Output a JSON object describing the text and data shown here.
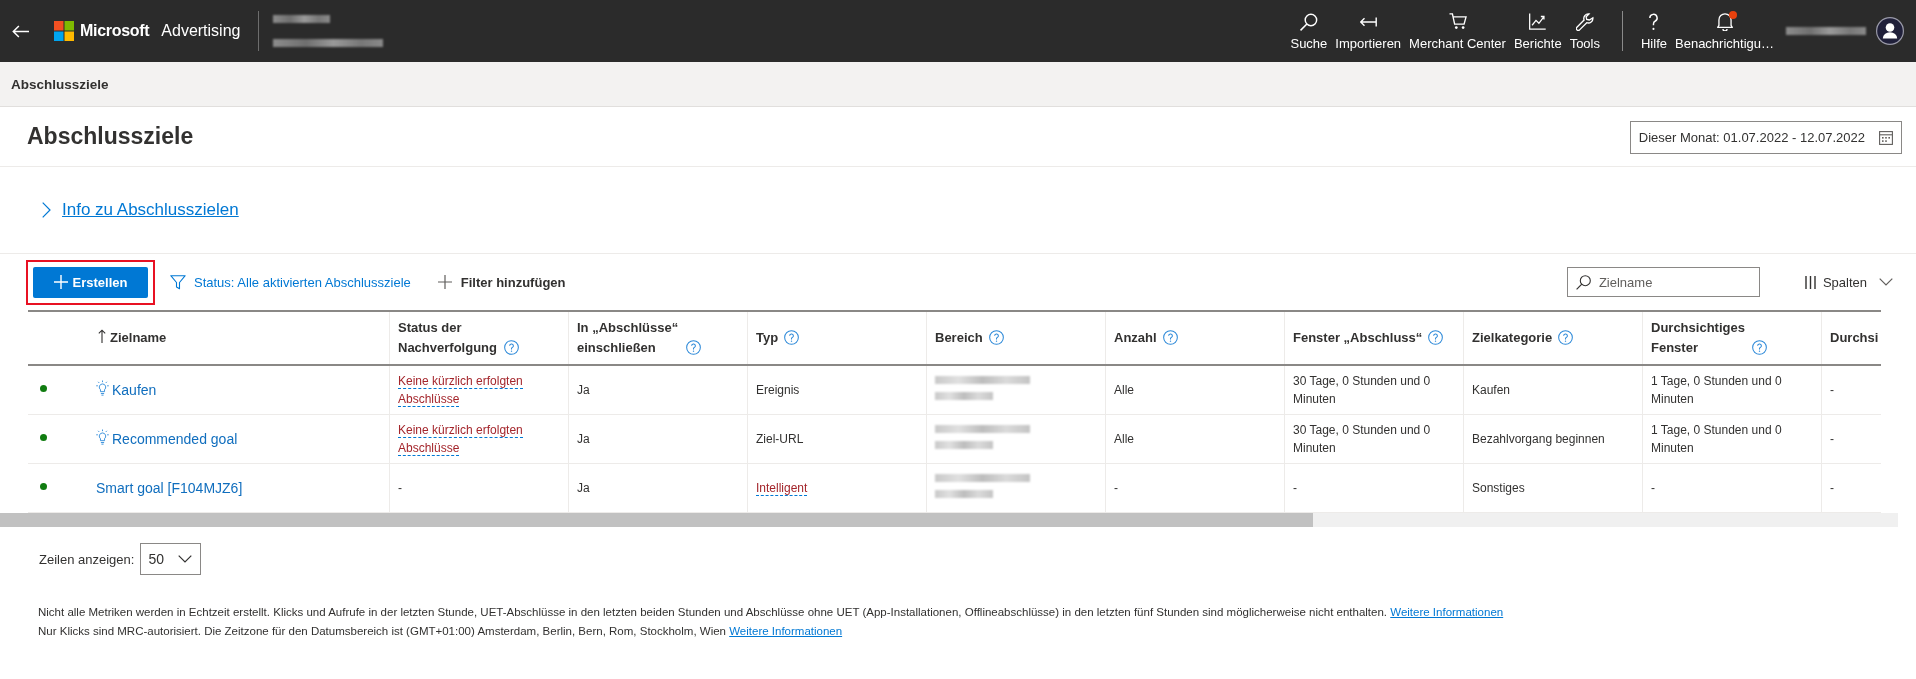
{
  "top_bar": {
    "brand": "Microsoft",
    "product": "Advertising",
    "account": {
      "blurred": true
    },
    "nav_primary": [
      {
        "kind": "search",
        "label": "Suche"
      },
      {
        "kind": "import",
        "label": "Importieren"
      },
      {
        "kind": "cart",
        "label": "Merchant Center"
      },
      {
        "kind": "chart",
        "label": "Berichte"
      },
      {
        "kind": "wrench",
        "label": "Tools"
      }
    ],
    "nav_secondary": [
      {
        "kind": "help",
        "label": "Hilfe"
      },
      {
        "kind": "bell",
        "label": "Benachrichtigu…",
        "badge": true
      }
    ],
    "user": {
      "blurred_name": true
    }
  },
  "breadcrumb": "Abschlussziele",
  "page": {
    "title": "Abschlussziele",
    "date_range": "Dieser Monat: 01.07.2022 - 12.07.2022",
    "info_link": {
      "label": "Info zu Abschlusszielen",
      "expanded": false
    }
  },
  "toolbar": {
    "create_button": {
      "label": "Erstellen",
      "highlighted": true
    },
    "status_filter": "Status: Alle aktivierten Abschlussziele",
    "add_filter": "Filter hinzufügen",
    "search": {
      "placeholder": "Zielname"
    },
    "columns_button": "Spalten"
  },
  "table": {
    "columns": [
      {
        "label": "Zielname",
        "sort_ascending": true,
        "help": false
      },
      {
        "label": "Status der Nachverfolgung",
        "help": true
      },
      {
        "label": "In „Abschlüsse“ einschließen",
        "help": true
      },
      {
        "label": "Typ",
        "help": true
      },
      {
        "label": "Bereich",
        "help": true
      },
      {
        "label": "Anzahl",
        "help": true
      },
      {
        "label": "Fenster „Abschluss“",
        "help": true
      },
      {
        "label": "Zielkategorie",
        "help": true
      },
      {
        "label": "Durchsichtiges Fenster",
        "help": true
      },
      {
        "label": "Durchsi",
        "help": false
      }
    ],
    "rows": [
      {
        "color": "#107c10",
        "lightbulb": true,
        "cells": [
          {
            "kind": "link",
            "text": "Kaufen"
          },
          {
            "kind": "hint",
            "text": "Keine kürzlich erfolgten Abschlüsse"
          },
          {
            "kind": "plain",
            "text": "Ja"
          },
          {
            "kind": "plain",
            "text": "Ereignis"
          },
          {
            "kind": "redacted"
          },
          {
            "kind": "plain",
            "text": "Alle"
          },
          {
            "kind": "plain",
            "text": "30 Tage, 0 Stunden und 0 Minuten"
          },
          {
            "kind": "plain",
            "text": "Kaufen"
          },
          {
            "kind": "plain",
            "text": "1 Tage, 0 Stunden und 0 Minuten"
          },
          {
            "kind": "plain",
            "text": "-"
          }
        ]
      },
      {
        "color": "#107c10",
        "lightbulb": true,
        "cells": [
          {
            "kind": "link",
            "text": "Recommended goal"
          },
          {
            "kind": "hint",
            "text": "Keine kürzlich erfolgten Abschlüsse"
          },
          {
            "kind": "plain",
            "text": "Ja"
          },
          {
            "kind": "plain",
            "text": "Ziel-URL"
          },
          {
            "kind": "redacted"
          },
          {
            "kind": "plain",
            "text": "Alle"
          },
          {
            "kind": "plain",
            "text": "30 Tage, 0 Stunden und 0 Minuten"
          },
          {
            "kind": "plain",
            "text": "Bezahlvorgang beginnen"
          },
          {
            "kind": "plain",
            "text": "1 Tage, 0 Stunden und 0 Minuten"
          },
          {
            "kind": "plain",
            "text": "-"
          }
        ]
      },
      {
        "color": "#107c10",
        "lightbulb": false,
        "cells": [
          {
            "kind": "link",
            "text": "Smart goal [F104MJZ6]"
          },
          {
            "kind": "plain",
            "text": "-"
          },
          {
            "kind": "plain",
            "text": "Ja"
          },
          {
            "kind": "hint",
            "text": "Intelligent"
          },
          {
            "kind": "redacted"
          },
          {
            "kind": "plain",
            "text": "-"
          },
          {
            "kind": "plain",
            "text": "-"
          },
          {
            "kind": "plain",
            "text": "Sonstiges"
          },
          {
            "kind": "plain",
            "text": "-"
          },
          {
            "kind": "plain",
            "text": "-"
          }
        ]
      }
    ]
  },
  "pager": {
    "label": "Zeilen anzeigen:",
    "value": "50"
  },
  "footer": [
    {
      "text": "Nicht alle Metriken werden in Echtzeit erstellt. Klicks und Aufrufe in der letzten Stunde, UET-Abschlüsse in den letzten beiden Stunden und Abschlüsse ohne UET (App-Installationen, Offlineabschlüsse) in den letzten fünf Stunden sind möglicherweise nicht enthalten.",
      "link": "Weitere Informationen"
    },
    {
      "text": "Nur Klicks sind MRC-autorisiert. Die Zeitzone für den Datumsbereich ist (GMT+01:00) Amsterdam, Berlin, Bern, Rom, Stockholm, Wien",
      "link": "Weitere Informationen"
    }
  ]
}
